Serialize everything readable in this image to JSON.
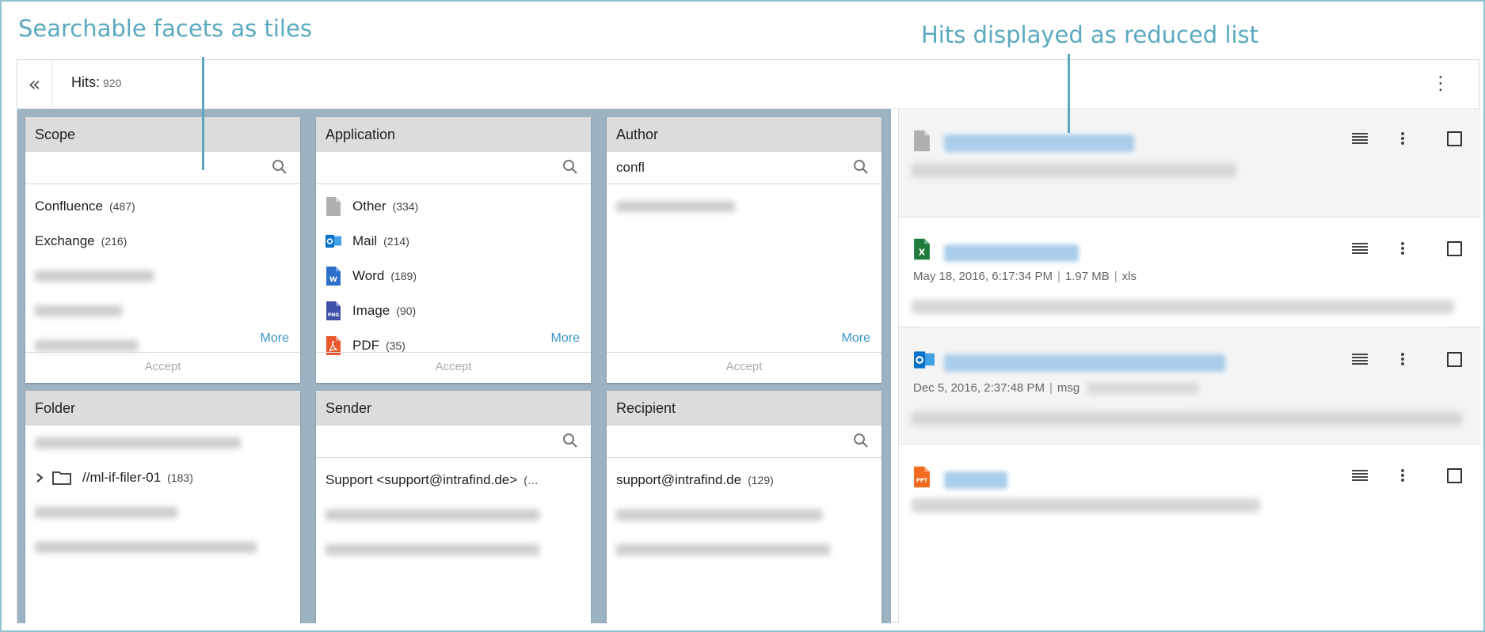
{
  "annotations": {
    "left": "Searchable facets as tiles",
    "right": "Hits displayed as reduced list"
  },
  "header": {
    "collapse_glyph": "«",
    "hits_label": "Hits:",
    "hits_count": "920",
    "menu_glyph": "⋮"
  },
  "tiles": {
    "scope": {
      "title": "Scope",
      "search_value": "",
      "items": [
        {
          "label": "Confluence",
          "count": "(487)"
        },
        {
          "label": "Exchange",
          "count": "(216)"
        }
      ],
      "more": "More",
      "accept": "Accept"
    },
    "application": {
      "title": "Application",
      "search_value": "",
      "items": [
        {
          "label": "Other",
          "count": "(334)",
          "icon": "generic-file-icon"
        },
        {
          "label": "Mail",
          "count": "(214)",
          "icon": "outlook-icon"
        },
        {
          "label": "Word",
          "count": "(189)",
          "icon": "word-icon"
        },
        {
          "label": "Image",
          "count": "(90)",
          "icon": "png-icon"
        },
        {
          "label": "PDF",
          "count": "(35)",
          "icon": "pdf-icon"
        }
      ],
      "more": "More",
      "accept": "Accept"
    },
    "author": {
      "title": "Author",
      "search_value": "confl",
      "more": "More",
      "accept": "Accept"
    },
    "folder": {
      "title": "Folder",
      "items": [
        {
          "label": "//ml-if-filer-01",
          "count": "(183)",
          "icon": "folder-icon"
        }
      ]
    },
    "sender": {
      "title": "Sender",
      "search_value": "",
      "items": [
        {
          "label": "Support <support@intrafind.de>",
          "count": "(…"
        }
      ]
    },
    "recipient": {
      "title": "Recipient",
      "search_value": "",
      "items": [
        {
          "label": "support@intrafind.de",
          "count": "(129)"
        }
      ]
    }
  },
  "hits": [
    {
      "type_icon": "generic-file-icon",
      "meta": null
    },
    {
      "type_icon": "excel-icon",
      "meta": {
        "date": "May 18, 2016, 6:17:34 PM",
        "size": "1.97 MB",
        "ext": "xls"
      }
    },
    {
      "type_icon": "outlook-icon",
      "meta": {
        "date": "Dec 5, 2016, 2:37:48 PM",
        "ext": "msg"
      }
    },
    {
      "type_icon": "ppt-icon",
      "meta": null
    }
  ],
  "colors": {
    "annotation": "#5aa9be",
    "tile_background": "#9db3c2",
    "link": "#3b96c7",
    "excel": "#1f7a3d",
    "outlook": "#0a72c6",
    "word": "#2b6fcb",
    "png": "#3f51a8",
    "pdf": "#e9572c",
    "ppt": "#f26a1e"
  }
}
